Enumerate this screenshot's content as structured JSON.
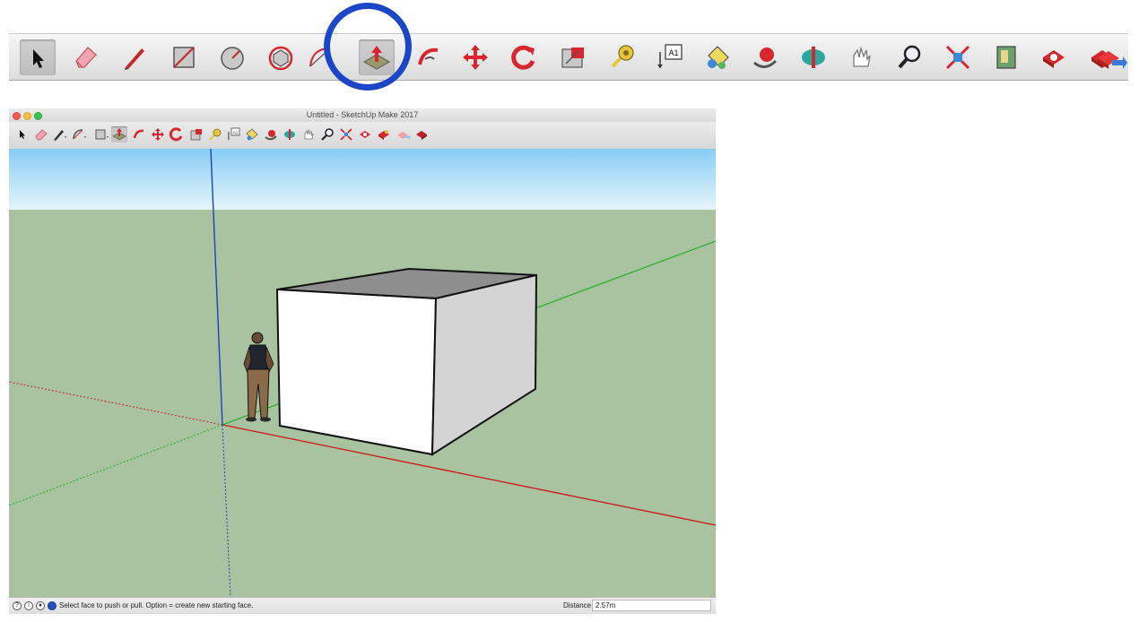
{
  "window": {
    "title": "Untitled - SketchUp Make 2017"
  },
  "big_toolbar": {
    "tools": [
      {
        "name": "select",
        "icon": "arrow-pointer-icon"
      },
      {
        "name": "eraser",
        "icon": "eraser-icon"
      },
      {
        "name": "line",
        "icon": "pencil-icon"
      },
      {
        "name": "rectangle",
        "icon": "rectangle-icon"
      },
      {
        "name": "circle",
        "icon": "circle-icon"
      },
      {
        "name": "polygon",
        "icon": "polygon-icon"
      },
      {
        "name": "arc",
        "icon": "arc-icon"
      },
      {
        "name": "push-pull",
        "icon": "push-pull-icon",
        "active": true
      },
      {
        "name": "follow-me",
        "icon": "follow-me-icon"
      },
      {
        "name": "move",
        "icon": "move-arrows-icon"
      },
      {
        "name": "rotate",
        "icon": "rotate-icon"
      },
      {
        "name": "scale",
        "icon": "scale-icon"
      },
      {
        "name": "tape-measure",
        "icon": "tape-measure-icon"
      },
      {
        "name": "text",
        "icon": "text-label-icon",
        "label": "A1"
      },
      {
        "name": "paint-bucket",
        "icon": "paint-bucket-icon"
      },
      {
        "name": "orbit",
        "icon": "orbit-icon"
      },
      {
        "name": "pan",
        "icon": "pan-icon"
      },
      {
        "name": "walk",
        "icon": "hand-icon"
      },
      {
        "name": "zoom",
        "icon": "zoom-magnifier-icon"
      },
      {
        "name": "zoom-extents",
        "icon": "zoom-extents-icon"
      },
      {
        "name": "position-camera",
        "icon": "map-icon"
      },
      {
        "name": "3d-warehouse",
        "icon": "warehouse-icon"
      },
      {
        "name": "extension-warehouse",
        "icon": "extension-icon"
      },
      {
        "name": "share-model",
        "icon": "share-model-icon"
      }
    ]
  },
  "small_toolbar": {
    "text_tool_label": "A1"
  },
  "status": {
    "hint": "Select face to push or pull.  Option = create new starting face.",
    "distance_label": "Distance",
    "distance_value": "2.57m"
  },
  "colors": {
    "sky_top": "#87cdf5",
    "sky_bottom": "#e6f5fc",
    "ground": "#a9c2a0",
    "axis_red": "#cc2020",
    "axis_green": "#20b020",
    "axis_blue": "#2040c0",
    "highlight": "#1c46c8",
    "accent_red": "#d8262e"
  }
}
